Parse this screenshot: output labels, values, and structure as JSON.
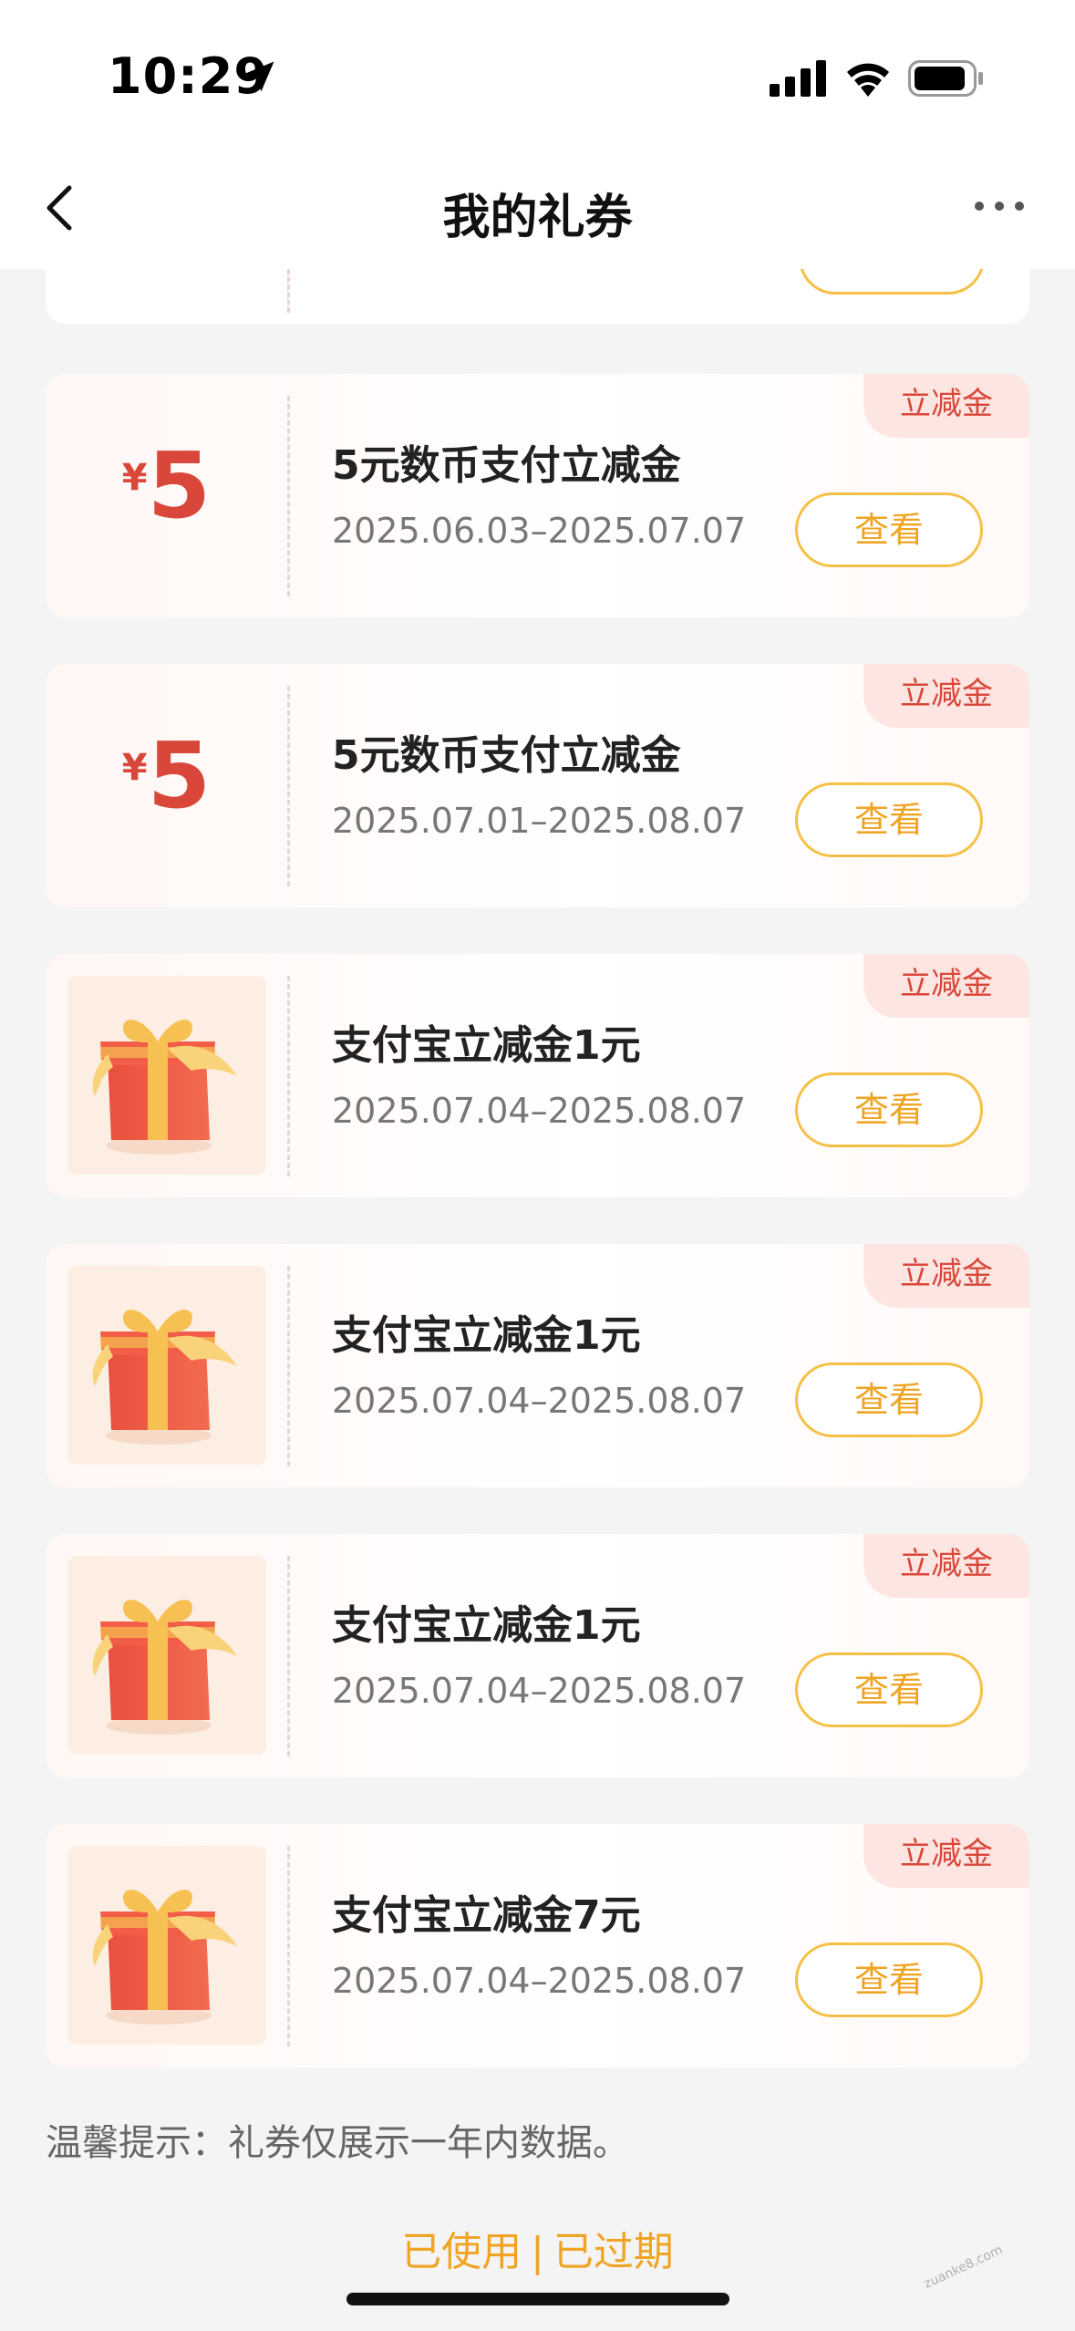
{
  "status_bar": {
    "time": "10:29"
  },
  "nav": {
    "title": "我的礼券"
  },
  "coupons": [
    {
      "kind": "amount",
      "currency": "¥",
      "amount": "5",
      "title": "5元数币支付立减金",
      "date": "2025.06.03–2025.07.07",
      "tag": "立减金",
      "button": "查看"
    },
    {
      "kind": "amount",
      "currency": "¥",
      "amount": "5",
      "title": "5元数币支付立减金",
      "date": "2025.07.01–2025.08.07",
      "tag": "立减金",
      "button": "查看"
    },
    {
      "kind": "gift",
      "title": "支付宝立减金1元",
      "date": "2025.07.04–2025.08.07",
      "tag": "立减金",
      "button": "查看"
    },
    {
      "kind": "gift",
      "title": "支付宝立减金1元",
      "date": "2025.07.04–2025.08.07",
      "tag": "立减金",
      "button": "查看"
    },
    {
      "kind": "gift",
      "title": "支付宝立减金1元",
      "date": "2025.07.04–2025.08.07",
      "tag": "立减金",
      "button": "查看"
    },
    {
      "kind": "gift",
      "title": "支付宝立减金7元",
      "date": "2025.07.04–2025.08.07",
      "tag": "立减金",
      "button": "查看"
    }
  ],
  "tip": "温馨提示：礼券仅展示一年内数据。",
  "footer": {
    "used": "已使用",
    "separator": "|",
    "expired": "已过期"
  },
  "colors": {
    "accent": "#f0a424",
    "amount_red": "#d9473b",
    "background": "#f4f4f4"
  },
  "icons": [
    "location-arrow-icon",
    "signal-icon",
    "wifi-icon",
    "battery-icon",
    "back-chevron-icon",
    "more-dots-icon",
    "gift-box-icon"
  ]
}
